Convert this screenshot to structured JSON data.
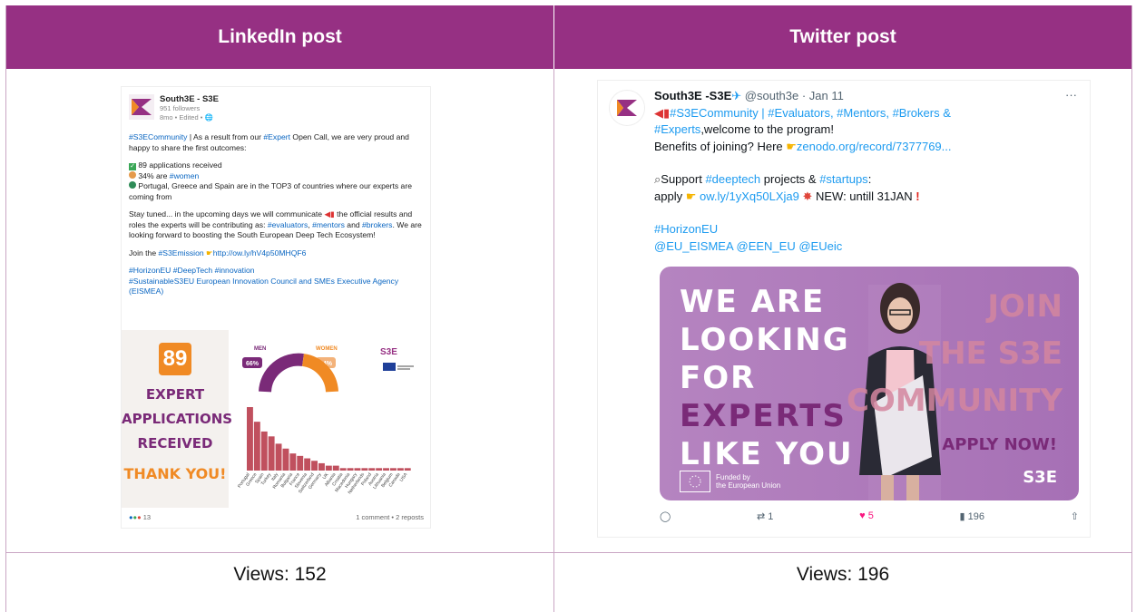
{
  "headers": {
    "left": "LinkedIn post",
    "right": "Twitter post"
  },
  "views": {
    "left": "Views: 152",
    "right": "Views: 196"
  },
  "linkedin": {
    "name": "South3E - S3E",
    "followers": "951 followers",
    "meta": "8mo • Edited •",
    "p1_tag1": "#S3ECommunity",
    "p1_a": " | As a result from our ",
    "p1_tag2": "#Expert",
    "p1_b": " Open Call, we are very proud and happy to share the first outcomes:",
    "l1": "89 applications received",
    "l2a": "34% are ",
    "l2_tag": "#women",
    "l3": "Portugal, Greece and Spain are in the TOP3 of countries where our experts are coming from",
    "p3a": "Stay tuned... in the upcoming days we will communicate ",
    "p3b": " the official results and roles the experts will be contributing as: ",
    "t_eval": "#evaluators",
    "t_ment": "#mentors",
    "t_and": " and ",
    "t_brok": "#brokers",
    "p3c": ". We are looking forward to boosting the South European Deep Tech Ecosystem!",
    "p4a": "Join the ",
    "p4_tag": "#S3Emission",
    "p4_link": "http://ow.ly/hV4p50MHQF6",
    "h1": "#HorizonEU #DeepTech #innovation",
    "h2": "#SustainableS3EU European Innovation Council and SMEs Executive Agency (EISMEA)",
    "img_num": "89",
    "img_l1": "EXPERT",
    "img_l2": "APPLICATIONS",
    "img_l3": "RECEIVED",
    "img_thanks": "THANK YOU!",
    "img_men": "MEN",
    "img_women": "WOMEN",
    "img_men_pct": "66%",
    "img_women_pct": "34%",
    "img_logo": "S3E",
    "countries": [
      "Portugal",
      "Greece",
      "Spain",
      "Turkey",
      "Italy",
      "Romania",
      "Bulgaria",
      "France",
      "Slovenia",
      "Switzerland",
      "Germany",
      "UK",
      "Albania",
      "Croatia",
      "Macedonia",
      "Hungary",
      "Netherlands",
      "Poland",
      "Austria",
      "Lithuania",
      "Belgium",
      "Canada",
      "USA"
    ],
    "bar_values": [
      26,
      20,
      16,
      14,
      11,
      9,
      7,
      6,
      5,
      4,
      3,
      2,
      2,
      1,
      1,
      1,
      1,
      1,
      1,
      1,
      1,
      1,
      1
    ],
    "reactions": "13",
    "comments": "1 comment • 2 reposts"
  },
  "twitter": {
    "name": "South3E -S3E",
    "handle": "@south3e · Jan 11",
    "more": "···",
    "tags1": "#S3ECommunity | #Evaluators, #Mentors, #Brokers &",
    "tags2": "#Experts",
    "welcome": ",welcome to the program!",
    "benefits": "Benefits of joining? Here ",
    "zenodo": "zenodo.org/record/7377769...",
    "support_a": "Support ",
    "support_t1": "#deeptech",
    "support_b": " projects & ",
    "support_t2": "#startups",
    "support_c": ":",
    "apply_a": "apply ",
    "apply_link": "ow.ly/1yXq50LXja9",
    "apply_b": " NEW: untill 31JAN ",
    "horizon": "#HorizonEU",
    "mentions": "@EU_EISMEA @EEN_EU @EUeic",
    "img_we": "WE ARE",
    "img_looking": "LOOKING",
    "img_for": "FOR",
    "img_experts": "EXPERTS",
    "img_like": "LIKE YOU",
    "img_join1": "JOIN",
    "img_join2": "THE S3E",
    "img_join3": "COMMUNITY",
    "img_apply": "APPLY NOW!",
    "img_funded": "Funded by\nthe European Union",
    "img_logo": "S3E",
    "retweets": "1",
    "likes": "5",
    "views": "196"
  },
  "colors": {
    "header": "#963083",
    "link_li": "#0a66c2",
    "link_tw": "#1d9bf0",
    "orange": "#f08a24",
    "purple": "#7a2a78"
  }
}
